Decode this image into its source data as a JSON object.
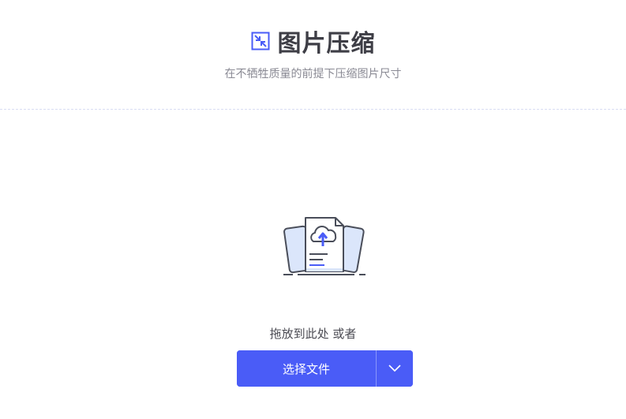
{
  "header": {
    "icon": "compress-arrows-icon",
    "title": "图片压缩",
    "subtitle": "在不牺牲质量的前提下压缩图片尺寸"
  },
  "drop_zone": {
    "illustration": "file-upload-cloud-icon",
    "hint": "拖放到此处 或者"
  },
  "actions": {
    "select_file_label": "选择文件",
    "dropdown_icon": "chevron-down-icon"
  },
  "colors": {
    "accent": "#4a5cf7",
    "title": "#3e3e46",
    "subtitle": "#8a8a94"
  }
}
